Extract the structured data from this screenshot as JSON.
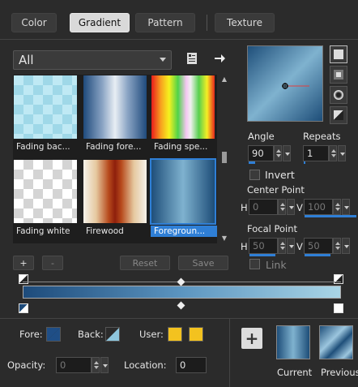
{
  "tabs": [
    {
      "label": "Color",
      "active": false
    },
    {
      "label": "Gradient",
      "active": true
    },
    {
      "label": "Pattern",
      "active": false
    },
    {
      "label": "Texture",
      "active": false
    }
  ],
  "category": {
    "value": "All"
  },
  "gradients": [
    {
      "label": "Fading bac..."
    },
    {
      "label": "Fading fore..."
    },
    {
      "label": "Fading spe..."
    },
    {
      "label": "Fading white"
    },
    {
      "label": "Firewood"
    },
    {
      "label": "Foregroun...",
      "selected": true
    }
  ],
  "grid_buttons": {
    "add": "+",
    "remove": "-",
    "reset": "Reset",
    "save": "Save"
  },
  "angle": {
    "label": "Angle",
    "value": "90",
    "fill_fraction": 0.25
  },
  "repeats": {
    "label": "Repeats",
    "value": "1",
    "fill_fraction": 0.05
  },
  "invert": {
    "label": "Invert",
    "checked": false
  },
  "center_point": {
    "label": "Center Point",
    "h_label": "H",
    "h_value": "0",
    "v_label": "V",
    "v_value": "100"
  },
  "focal_point": {
    "label": "Focal Point",
    "h_label": "H",
    "h_value": "50",
    "v_label": "V",
    "v_value": "50"
  },
  "link": {
    "label": "Link",
    "checked": false
  },
  "gradient_colors": {
    "start": "#1d4b7b",
    "mid": "#5c95c0",
    "end": "#a9d5e6"
  },
  "bottom": {
    "fore_label": "Fore:",
    "back_label": "Back:",
    "user_label": "User:",
    "opacity_label": "Opacity:",
    "opacity_value": "0",
    "location_label": "Location:",
    "location_value": "0",
    "current_label": "Current",
    "previous_label": "Previous",
    "add_button": "+"
  },
  "colors": {
    "fore": "#1f4e86",
    "back": "#8ec6dd",
    "user1": "#f3c21f",
    "user2": "#f3c21f",
    "accent": "#2f7fd6"
  }
}
